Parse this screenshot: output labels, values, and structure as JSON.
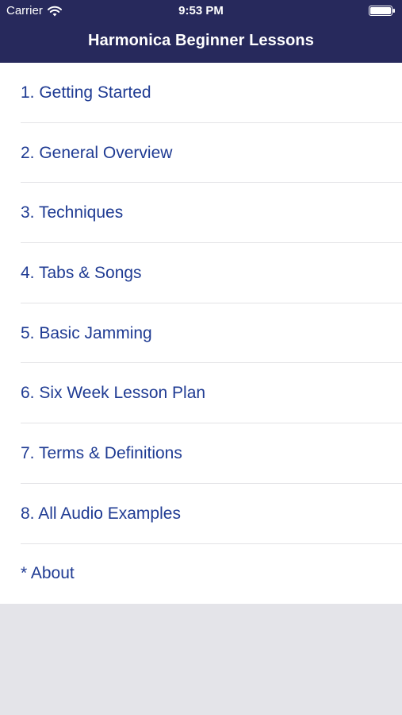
{
  "status_bar": {
    "carrier": "Carrier",
    "time": "9:53 PM",
    "wifi_icon": "wifi-icon",
    "battery_icon": "battery-icon"
  },
  "nav": {
    "title": "Harmonica Beginner Lessons"
  },
  "lessons": [
    {
      "label": "1. Getting Started"
    },
    {
      "label": "2. General Overview"
    },
    {
      "label": "3. Techniques"
    },
    {
      "label": "4. Tabs & Songs"
    },
    {
      "label": "5. Basic Jamming"
    },
    {
      "label": "6. Six Week Lesson Plan"
    },
    {
      "label": "7. Terms & Definitions"
    },
    {
      "label": "8. All Audio Examples"
    },
    {
      "label": "* About"
    }
  ],
  "colors": {
    "nav_background": "#27295c",
    "link_text": "#1f3b93",
    "list_background": "#ffffff",
    "page_background": "#e4e4e9"
  }
}
